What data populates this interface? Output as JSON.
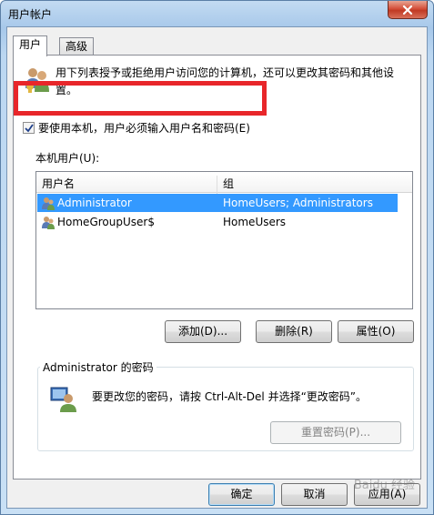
{
  "window": {
    "title": "用户帐户",
    "close_icon": "close-x-icon"
  },
  "tabs": [
    {
      "label": "用户",
      "active": true
    },
    {
      "label": "高级",
      "active": false
    }
  ],
  "users_tab": {
    "description": "用下列表授予或拒绝用户访问您的计算机，还可以更改其密码和其他设置。",
    "require_login_checkbox": {
      "label": "要使用本机，用户必须输入用户名和密码(E)",
      "checked": true
    },
    "list_label": "本机用户(U):",
    "columns": [
      "用户名",
      "组"
    ],
    "rows": [
      {
        "name": "Administrator",
        "group": "HomeUsers; Administrators",
        "selected": true
      },
      {
        "name": "HomeGroupUser$",
        "group": "HomeUsers",
        "selected": false
      }
    ],
    "buttons": {
      "add": "添加(D)...",
      "remove": "删除(R)",
      "properties": "属性(O)"
    },
    "password_group": {
      "title": "Administrator 的密码",
      "text": "要更改您的密码，请按 Ctrl-Alt-Del 并选择“更改密码”。",
      "reset_button": "重置密码(P)..."
    }
  },
  "footer": {
    "ok": "确定",
    "cancel": "取消",
    "apply": "应用(A)"
  },
  "watermark": "Baidu 经验",
  "colors": {
    "selection": "#3399ff",
    "highlight_box": "#e8262a"
  }
}
